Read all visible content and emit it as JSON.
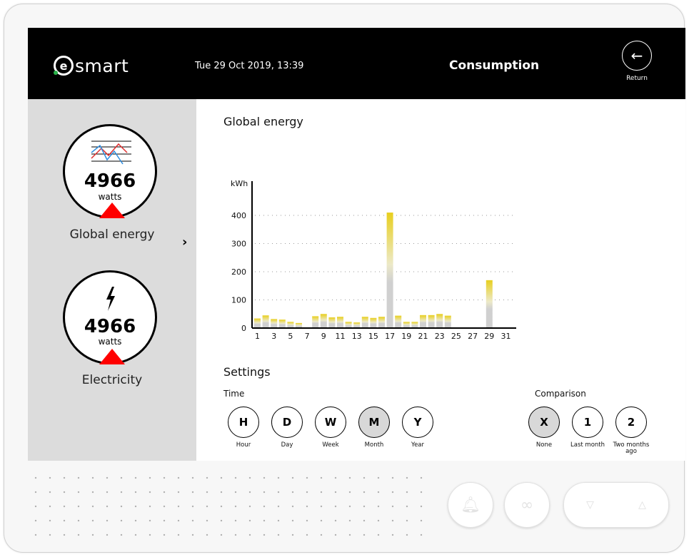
{
  "header": {
    "logo_letter": "e",
    "logo_text": "smart",
    "datetime": "Tue 29 Oct 2019, 13:39",
    "title": "Consumption",
    "return_label": "Return"
  },
  "sidebar": {
    "gauges": [
      {
        "value": "4966",
        "unit": "watts",
        "label": "Global energy",
        "icon": "line-chart-icon"
      },
      {
        "value": "4966",
        "unit": "watts",
        "label": "Electricity",
        "icon": "lightning-icon"
      }
    ],
    "indicator_color": "#ff0000"
  },
  "main": {
    "title": "Global energy"
  },
  "chart_data": {
    "type": "bar",
    "ylabel": "kWh",
    "ylim": [
      0,
      450
    ],
    "yticks": [
      0,
      100,
      200,
      300,
      400
    ],
    "xticks": [
      "1",
      "3",
      "5",
      "7",
      "9",
      "11",
      "13",
      "15",
      "17",
      "19",
      "21",
      "23",
      "25",
      "27",
      "29",
      "31"
    ],
    "days": [
      1,
      2,
      3,
      4,
      5,
      6,
      7,
      8,
      9,
      10,
      11,
      12,
      13,
      14,
      15,
      16,
      17,
      18,
      19,
      20,
      21,
      22,
      23,
      24,
      25,
      26,
      27,
      28,
      29,
      30,
      31
    ],
    "values": [
      34,
      45,
      32,
      30,
      22,
      18,
      0,
      42,
      50,
      38,
      40,
      22,
      20,
      40,
      36,
      40,
      410,
      44,
      22,
      22,
      46,
      46,
      50,
      44,
      0,
      0,
      0,
      0,
      170,
      0,
      0
    ],
    "grid": "dotted horizontal",
    "colors": {
      "top": "#e8cf1e",
      "base": "#d0d0d0"
    }
  },
  "settings": {
    "title": "Settings",
    "time_label": "Time",
    "time_options": [
      {
        "key": "H",
        "caption": "Hour",
        "selected": false
      },
      {
        "key": "D",
        "caption": "Day",
        "selected": false
      },
      {
        "key": "W",
        "caption": "Week",
        "selected": false
      },
      {
        "key": "M",
        "caption": "Month",
        "selected": true
      },
      {
        "key": "Y",
        "caption": "Year",
        "selected": false
      }
    ],
    "comparison_label": "Comparison",
    "comparison_options": [
      {
        "key": "X",
        "caption": "None",
        "selected": true
      },
      {
        "key": "1",
        "caption": "Last month",
        "selected": false
      },
      {
        "key": "2",
        "caption": "Two months ago",
        "selected": false
      }
    ]
  },
  "hardware": {
    "buttons": [
      "bell-icon",
      "link-icon",
      "chevron-down-icon",
      "chevron-up-icon"
    ]
  }
}
